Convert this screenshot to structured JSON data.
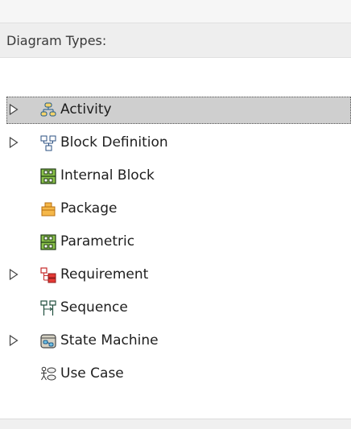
{
  "panel": {
    "header": "Diagram Types:"
  },
  "tree": {
    "items": [
      {
        "label": "Activity",
        "icon": "activity-diagram-icon",
        "expandable": true,
        "selected": true
      },
      {
        "label": "Block Definition",
        "icon": "block-definition-icon",
        "expandable": true,
        "selected": false
      },
      {
        "label": "Internal Block",
        "icon": "internal-block-icon",
        "expandable": false,
        "selected": false
      },
      {
        "label": "Package",
        "icon": "package-icon",
        "expandable": false,
        "selected": false
      },
      {
        "label": "Parametric",
        "icon": "parametric-icon",
        "expandable": false,
        "selected": false
      },
      {
        "label": "Requirement",
        "icon": "requirement-icon",
        "expandable": true,
        "selected": false
      },
      {
        "label": "Sequence",
        "icon": "sequence-icon",
        "expandable": false,
        "selected": false
      },
      {
        "label": "State Machine",
        "icon": "state-machine-icon",
        "expandable": true,
        "selected": false
      },
      {
        "label": "Use Case",
        "icon": "use-case-icon",
        "expandable": false,
        "selected": false
      }
    ]
  }
}
